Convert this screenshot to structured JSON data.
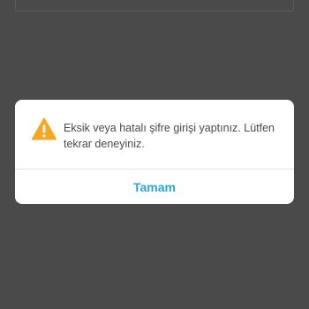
{
  "dialog": {
    "icon": "warning-icon",
    "icon_color": "#f5a623",
    "message": "Eksik veya hatalı şifre girişi yaptınız. Lütfen tekrar deneyiniz.",
    "ok_label": "Tamam",
    "ok_color": "#2aa5d9"
  }
}
